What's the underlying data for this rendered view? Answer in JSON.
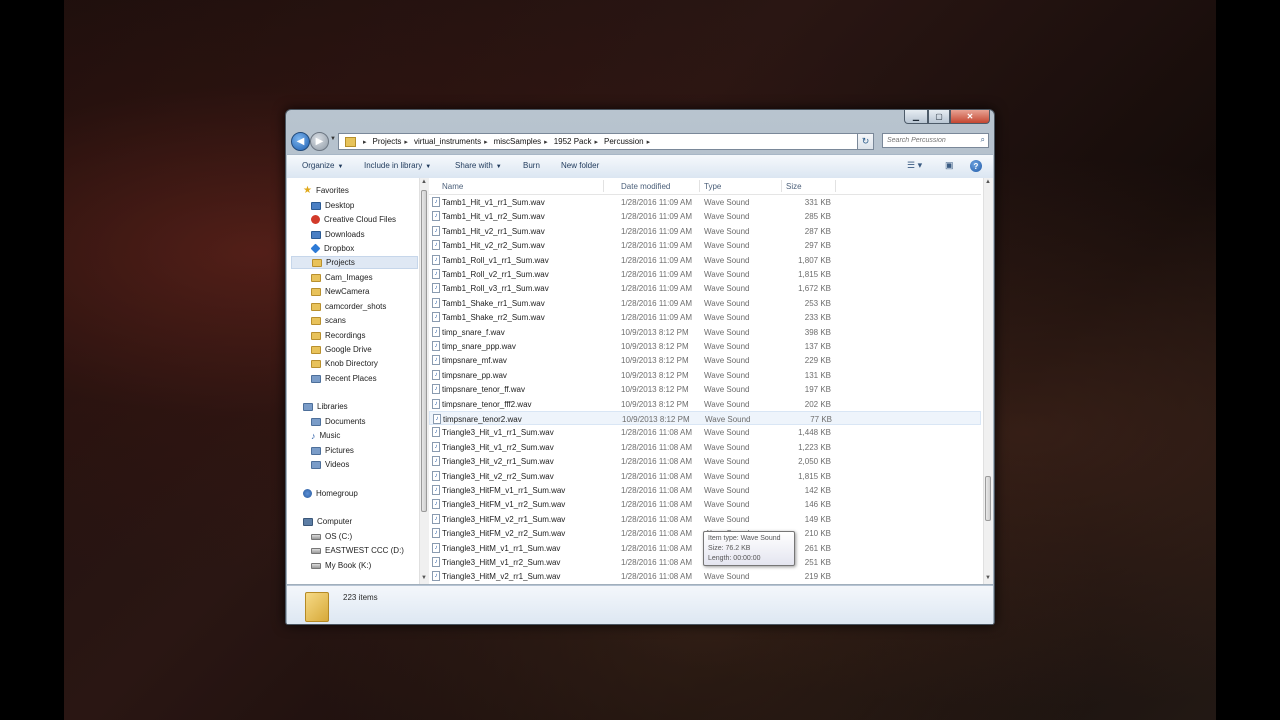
{
  "address": {
    "crumbs": [
      "Projects",
      "virtual_instruments",
      "miscSamples",
      "1952 Pack",
      "Percussion"
    ],
    "search_placeholder": "Search Percussion"
  },
  "toolbar": {
    "organize": "Organize",
    "include": "Include in library",
    "share": "Share with",
    "burn": "Burn",
    "new_folder": "New folder"
  },
  "nav": {
    "favorites": "Favorites",
    "desktop": "Desktop",
    "creative_cloud": "Creative Cloud Files",
    "downloads": "Downloads",
    "dropbox": "Dropbox",
    "projects": "Projects",
    "cam_images": "Cam_Images",
    "newcamera": "NewCamera",
    "camcorder": "camcorder_shots",
    "scans": "scans",
    "recordings": "Recordings",
    "google_drive": "Google Drive",
    "knob": "Knob Directory",
    "recent": "Recent Places",
    "libraries": "Libraries",
    "documents": "Documents",
    "music": "Music",
    "pictures": "Pictures",
    "videos": "Videos",
    "homegroup": "Homegroup",
    "computer": "Computer",
    "os": "OS (C:)",
    "eastwest": "EASTWEST CCC (D:)",
    "mybook": "My Book (K:)"
  },
  "columns": {
    "name": "Name",
    "date": "Date modified",
    "type": "Type",
    "size": "Size"
  },
  "files": [
    {
      "name": "Tamb1_Hit_v1_rr1_Sum.wav",
      "date": "1/28/2016 11:09 AM",
      "type": "Wave Sound",
      "size": "331 KB"
    },
    {
      "name": "Tamb1_Hit_v1_rr2_Sum.wav",
      "date": "1/28/2016 11:09 AM",
      "type": "Wave Sound",
      "size": "285 KB"
    },
    {
      "name": "Tamb1_Hit_v2_rr1_Sum.wav",
      "date": "1/28/2016 11:09 AM",
      "type": "Wave Sound",
      "size": "287 KB"
    },
    {
      "name": "Tamb1_Hit_v2_rr2_Sum.wav",
      "date": "1/28/2016 11:09 AM",
      "type": "Wave Sound",
      "size": "297 KB"
    },
    {
      "name": "Tamb1_Roll_v1_rr1_Sum.wav",
      "date": "1/28/2016 11:09 AM",
      "type": "Wave Sound",
      "size": "1,807 KB"
    },
    {
      "name": "Tamb1_Roll_v2_rr1_Sum.wav",
      "date": "1/28/2016 11:09 AM",
      "type": "Wave Sound",
      "size": "1,815 KB"
    },
    {
      "name": "Tamb1_Roll_v3_rr1_Sum.wav",
      "date": "1/28/2016 11:09 AM",
      "type": "Wave Sound",
      "size": "1,672 KB"
    },
    {
      "name": "Tamb1_Shake_rr1_Sum.wav",
      "date": "1/28/2016 11:09 AM",
      "type": "Wave Sound",
      "size": "253 KB"
    },
    {
      "name": "Tamb1_Shake_rr2_Sum.wav",
      "date": "1/28/2016 11:09 AM",
      "type": "Wave Sound",
      "size": "233 KB"
    },
    {
      "name": "timp_snare_f.wav",
      "date": "10/9/2013 8:12 PM",
      "type": "Wave Sound",
      "size": "398 KB"
    },
    {
      "name": "timp_snare_ppp.wav",
      "date": "10/9/2013 8:12 PM",
      "type": "Wave Sound",
      "size": "137 KB"
    },
    {
      "name": "timpsnare_mf.wav",
      "date": "10/9/2013 8:12 PM",
      "type": "Wave Sound",
      "size": "229 KB"
    },
    {
      "name": "timpsnare_pp.wav",
      "date": "10/9/2013 8:12 PM",
      "type": "Wave Sound",
      "size": "131 KB"
    },
    {
      "name": "timpsnare_tenor_ff.wav",
      "date": "10/9/2013 8:12 PM",
      "type": "Wave Sound",
      "size": "197 KB"
    },
    {
      "name": "timpsnare_tenor_fff2.wav",
      "date": "10/9/2013 8:12 PM",
      "type": "Wave Sound",
      "size": "202 KB"
    },
    {
      "name": "timpsnare_tenor2.wav",
      "date": "10/9/2013 8:12 PM",
      "type": "Wave Sound",
      "size": "77 KB"
    },
    {
      "name": "Triangle3_Hit_v1_rr1_Sum.wav",
      "date": "1/28/2016 11:08 AM",
      "type": "Wave Sound",
      "size": "1,448 KB"
    },
    {
      "name": "Triangle3_Hit_v1_rr2_Sum.wav",
      "date": "1/28/2016 11:08 AM",
      "type": "Wave Sound",
      "size": "1,223 KB"
    },
    {
      "name": "Triangle3_Hit_v2_rr1_Sum.wav",
      "date": "1/28/2016 11:08 AM",
      "type": "Wave Sound",
      "size": "2,050 KB"
    },
    {
      "name": "Triangle3_Hit_v2_rr2_Sum.wav",
      "date": "1/28/2016 11:08 AM",
      "type": "Wave Sound",
      "size": "1,815 KB"
    },
    {
      "name": "Triangle3_HitFM_v1_rr1_Sum.wav",
      "date": "1/28/2016 11:08 AM",
      "type": "Wave Sound",
      "size": "142 KB"
    },
    {
      "name": "Triangle3_HitFM_v1_rr2_Sum.wav",
      "date": "1/28/2016 11:08 AM",
      "type": "Wave Sound",
      "size": "146 KB"
    },
    {
      "name": "Triangle3_HitFM_v2_rr1_Sum.wav",
      "date": "1/28/2016 11:08 AM",
      "type": "Wave Sound",
      "size": "149 KB"
    },
    {
      "name": "Triangle3_HitFM_v2_rr2_Sum.wav",
      "date": "1/28/2016 11:08 AM",
      "type": "Wave Sound",
      "size": "210 KB"
    },
    {
      "name": "Triangle3_HitM_v1_rr1_Sum.wav",
      "date": "1/28/2016 11:08 AM",
      "type": "Wave Sound",
      "size": "261 KB"
    },
    {
      "name": "Triangle3_HitM_v1_rr2_Sum.wav",
      "date": "1/28/2016 11:08 AM",
      "type": "Wave Sound",
      "size": "251 KB"
    },
    {
      "name": "Triangle3_HitM_v2_rr1_Sum.wav",
      "date": "1/28/2016 11:08 AM",
      "type": "Wave Sound",
      "size": "219 KB"
    }
  ],
  "tooltip": {
    "type": "Item type: Wave Sound",
    "size": "Size: 76.2 KB",
    "length": "Length: 00:00:00"
  },
  "details": {
    "count": "223 items"
  }
}
